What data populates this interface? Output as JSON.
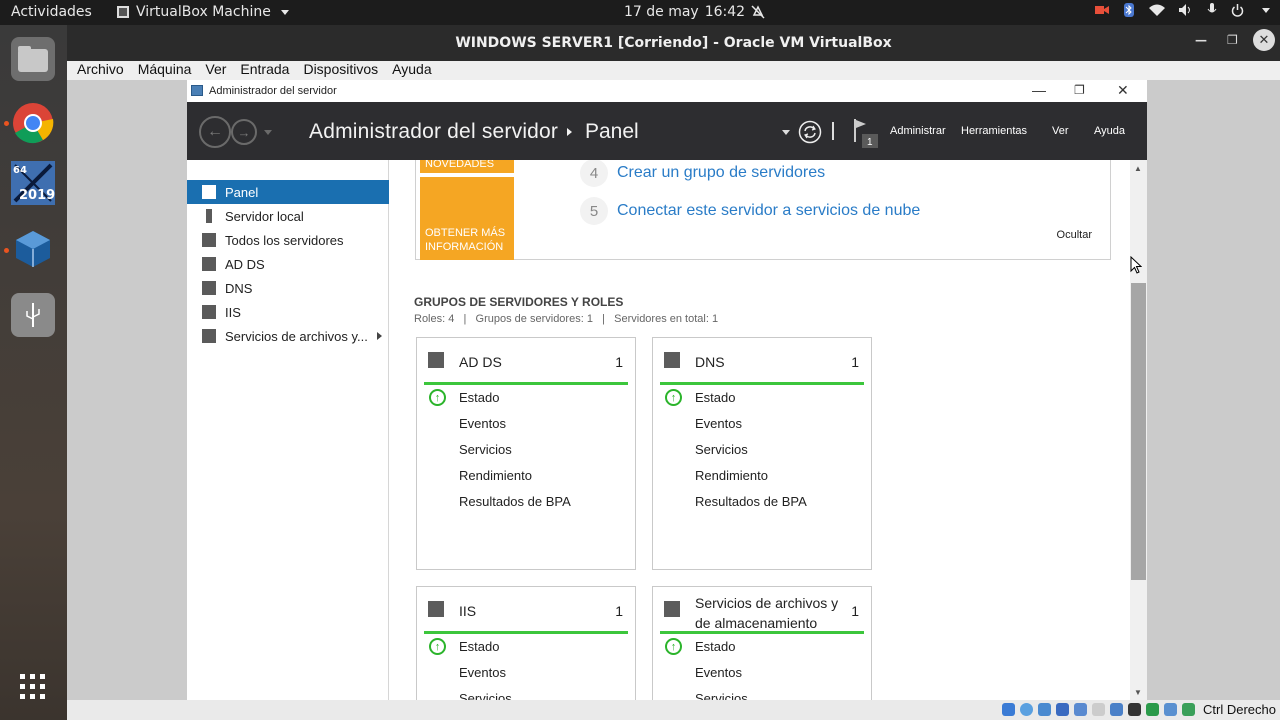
{
  "topbar": {
    "activities": "Actividades",
    "app_name": "VirtualBox Machine",
    "date": "17 de may",
    "time": "16:42"
  },
  "dock": {
    "items": [
      "files-icon",
      "chrome-icon",
      "windows-2019-icon",
      "virtualbox-icon",
      "usb-icon"
    ],
    "badge_64": "64",
    "badge_2019": "2019"
  },
  "vbox": {
    "title": "WINDOWS SERVER1 [Corriendo] - Oracle VM VirtualBox",
    "menu": [
      "Archivo",
      "Máquina",
      "Ver",
      "Entrada",
      "Dispositivos",
      "Ayuda"
    ],
    "host_key": "Ctrl Derecho"
  },
  "sm": {
    "window_title": "Administrador del servidor",
    "header_title": "Administrador del servidor",
    "header_crumb": "Panel",
    "flag_count": "1",
    "menu": [
      "Administrar",
      "Herramientas",
      "Ver",
      "Ayuda"
    ],
    "nav": [
      "Panel",
      "Servidor local",
      "Todos los servidores",
      "AD DS",
      "DNS",
      "IIS",
      "Servicios de archivos y..."
    ],
    "welcome": {
      "orange_top": "NOVEDADES",
      "orange_bottom": "OBTENER MÁS INFORMACIÓN",
      "steps": [
        {
          "num": "4",
          "text": "Crear un grupo de servidores"
        },
        {
          "num": "5",
          "text": "Conectar este servidor a servicios de nube"
        }
      ],
      "hide": "Ocultar"
    },
    "groups_title": "GRUPOS DE SERVIDORES Y ROLES",
    "groups_sub": "Roles: 4   |   Grupos de servidores: 1   |   Servidores en total: 1",
    "tiles": [
      {
        "name": "AD DS",
        "count": "1",
        "rows": [
          "Estado",
          "Eventos",
          "Servicios",
          "Rendimiento",
          "Resultados de BPA"
        ]
      },
      {
        "name": "DNS",
        "count": "1",
        "rows": [
          "Estado",
          "Eventos",
          "Servicios",
          "Rendimiento",
          "Resultados de BPA"
        ]
      },
      {
        "name": "IIS",
        "count": "1",
        "rows": [
          "Estado",
          "Eventos",
          "Servicios"
        ]
      },
      {
        "name": "Servicios de archivos y de almacenamiento",
        "count": "1",
        "rows": [
          "Estado",
          "Eventos",
          "Servicios"
        ]
      }
    ]
  }
}
